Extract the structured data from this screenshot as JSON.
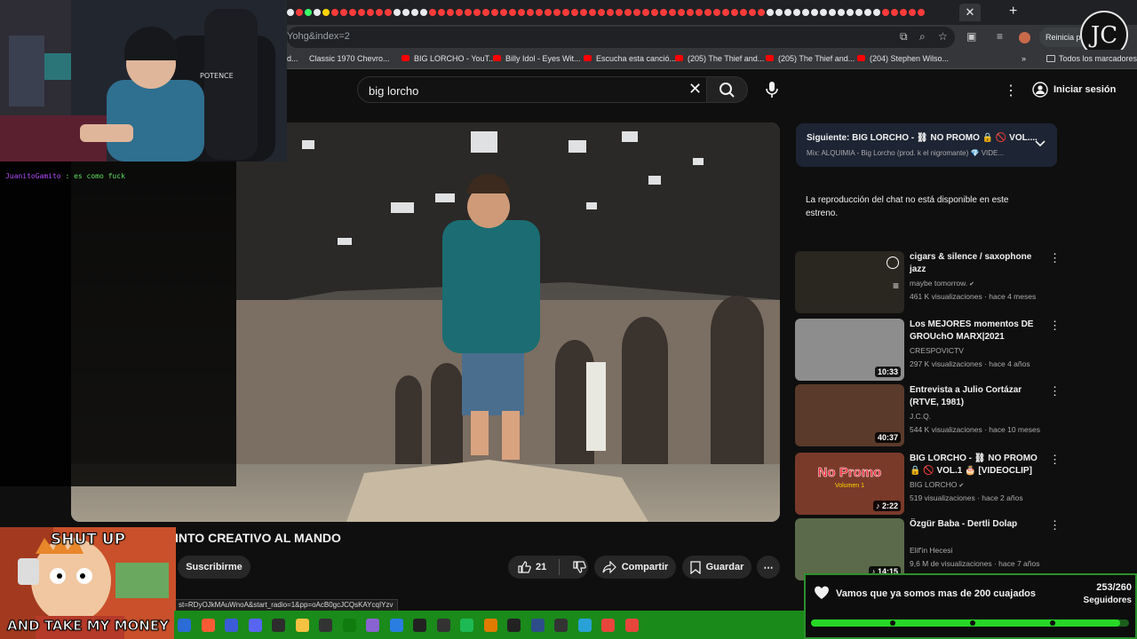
{
  "browser": {
    "url": "Yohg&index=2",
    "restart_label": "Reinicia para",
    "active_tab_close": "✕",
    "new_tab": "+",
    "bookmarks": [
      {
        "label": "d...",
        "type": "plain"
      },
      {
        "label": "Classic 1970 Chevro...",
        "type": "plain"
      },
      {
        "label": "BIG LORCHO - YouT...",
        "type": "yt"
      },
      {
        "label": "Billy Idol - Eyes Wit...",
        "type": "yt"
      },
      {
        "label": "Escucha esta canció...",
        "type": "yt"
      },
      {
        "label": "(205) The Thief and...",
        "type": "yt"
      },
      {
        "label": "(205) The Thief and...",
        "type": "yt"
      },
      {
        "label": "(204) Stephen Wilso...",
        "type": "yt"
      }
    ],
    "bookmarks_overflow": "»",
    "all_bookmarks": "Todos los marcadores",
    "tab_colors": [
      "#e8eaed",
      "#ff3b3b",
      "#3bff6b",
      "#e8eaed",
      "#ffd400",
      "#ff3b3b",
      "#ff3b3b",
      "#ff3b3b",
      "#ff3b3b",
      "#ff3b3b",
      "#ff3b3b",
      "#ff3b3b",
      "#e8eaed",
      "#e8eaed",
      "#e8eaed",
      "#e8eaed",
      "#ff3b3b",
      "#ff3b3b",
      "#ff3b3b",
      "#ff3b3b",
      "#ff3b3b",
      "#ff3b3b",
      "#ff3b3b",
      "#ff3b3b",
      "#ff3b3b",
      "#ff3b3b",
      "#ff3b3b",
      "#ff3b3b",
      "#ff3b3b",
      "#ff3b3b",
      "#ff3b3b",
      "#ff3b3b",
      "#ff3b3b",
      "#ff3b3b",
      "#ff3b3b",
      "#ff3b3b",
      "#ff3b3b",
      "#ff3b3b",
      "#ff3b3b",
      "#ff3b3b",
      "#ff3b3b",
      "#ff3b3b",
      "#ff3b3b",
      "#ff3b3b",
      "#ff3b3b",
      "#ff3b3b",
      "#ff3b3b",
      "#ff3b3b",
      "#ff3b3b",
      "#ff3b3b",
      "#ff3b3b",
      "#ff3b3b",
      "#ff3b3b",
      "#ff3b3b",
      "#e8eaed",
      "#e8eaed",
      "#e8eaed",
      "#e8eaed",
      "#e8eaed",
      "#e8eaed",
      "#e8eaed",
      "#e8eaed",
      "#e8eaed",
      "#e8eaed",
      "#e8eaed",
      "#e8eaed",
      "#e8eaed",
      "#ff3b3b",
      "#ff3b3b",
      "#ff3b3b",
      "#ff3b3b",
      "#ff3b3b"
    ]
  },
  "youtube": {
    "search_value": "big lorcho",
    "sign_in": "Iniciar sesión",
    "video_title": "INTO CREATIVO AL MANDO",
    "subscribe": "Suscribirme",
    "likes": "21",
    "share": "Compartir",
    "save": "Guardar",
    "hover_url": "st=RDyOJkMAuWnoA&start_radio=1&pp=oAcB0gcJCQsKAYcqIYzv",
    "next": {
      "title": "Siguiente: BIG LORCHO - ⛓ NO PROMO 🔒 🚫 VOL....",
      "subtitle": "Mix: ALQUIMIA - Big Lorcho (prod. k el nigromante) 💎 VIDE..."
    },
    "chat_disabled": "La reproducción del chat no está disponible en este estreno.",
    "recommendations": [
      {
        "title": "cigars & silence / saxophone jazz",
        "channel": "maybe tomorrow.",
        "verified": true,
        "meta": "461 K visualizaciones · hace 4 meses",
        "duration": "",
        "thumb_bg": "#2a2620"
      },
      {
        "title": "Los MEJORES momentos DE GROUchO MARX|2021",
        "channel": "CRESPOVICTV",
        "verified": false,
        "meta": "297 K visualizaciones · hace 4 años",
        "duration": "10:33",
        "thumb_bg": "#8d8d8d"
      },
      {
        "title": "Entrevista a Julio Cortázar (RTVE, 1981)",
        "channel": "J.C.Q.",
        "verified": false,
        "meta": "544 K visualizaciones · hace 10 meses",
        "duration": "40:37",
        "thumb_bg": "#5a3a2a"
      },
      {
        "title": "BIG LORCHO - ⛓ NO PROMO 🔒 🚫 VOL.1 🎂 [VIDEOCLIP]",
        "channel": "BIG LORCHO",
        "verified": true,
        "meta": "519 visualizaciones · hace 2 años",
        "duration": "♪ 2:22",
        "thumb_bg": "#7a3a2a"
      },
      {
        "title": "Özgür Baba - Dertli Dolap",
        "channel": "Elif'in Hecesi",
        "verified": false,
        "meta": "9,6 M de visualizaciones · hace 7 años",
        "duration": "♪ 14:15",
        "thumb_bg": "#5b6a4a"
      }
    ],
    "no_promo_thumb_text": "No Promo",
    "no_promo_thumb_sub": "Volumen 1"
  },
  "stream_overlay": {
    "chat_user": "JuanitoGamito",
    "chat_msg": ": es como fuck",
    "follow_goal_text": "Vamos que ya somos mas de 200 cuajados",
    "follow_count": "253/260",
    "follow_label": "Seguidores",
    "follow_progress": 0.973,
    "meme_top": "SHUT UP",
    "meme_bottom": "AND TAKE MY MONEY",
    "webcam_chair_text": "POTENCE"
  },
  "taskbar_icons": [
    {
      "name": "app-icon",
      "color": "#2b6bd6"
    },
    {
      "name": "brave-icon",
      "color": "#ff5a36"
    },
    {
      "name": "vivaldi-icon",
      "color": "#3b5cd6"
    },
    {
      "name": "discord-icon",
      "color": "#5865f2"
    },
    {
      "name": "obs-icon",
      "color": "#2d2d2d"
    },
    {
      "name": "folder-icon",
      "color": "#f5c242"
    },
    {
      "name": "record-icon",
      "color": "#333"
    },
    {
      "name": "xbox-icon",
      "color": "#107c10"
    },
    {
      "name": "box-icon",
      "color": "#8a63d2"
    },
    {
      "name": "vscode-icon",
      "color": "#2a7de1"
    },
    {
      "name": "epic-icon",
      "color": "#222"
    },
    {
      "name": "unity-icon",
      "color": "#333"
    },
    {
      "name": "spotify-icon",
      "color": "#1db954"
    },
    {
      "name": "game-icon",
      "color": "#e07b00"
    },
    {
      "name": "cube-icon",
      "color": "#222"
    },
    {
      "name": "pen-icon",
      "color": "#2d4d8a"
    },
    {
      "name": "terminal-icon",
      "color": "#333"
    },
    {
      "name": "notes-icon",
      "color": "#2aa1d6"
    },
    {
      "name": "chrome-icon",
      "color": "#e8453c"
    },
    {
      "name": "chrome-alt-icon",
      "color": "#e8453c"
    }
  ]
}
